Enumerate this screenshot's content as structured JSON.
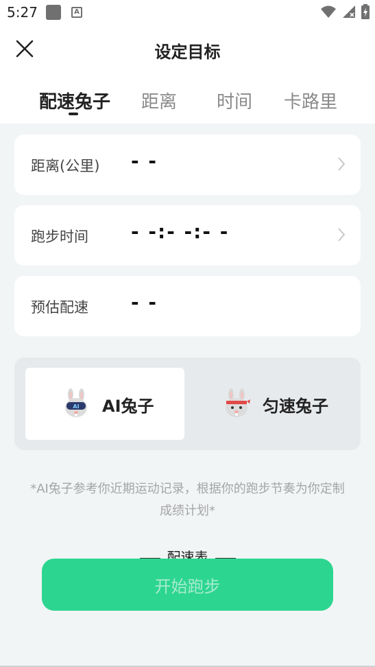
{
  "status_bar": {
    "time": "5:27"
  },
  "header": {
    "title": "设定目标",
    "tabs": [
      {
        "label": "配速兔子",
        "active": true
      },
      {
        "label": "距离",
        "active": false
      },
      {
        "label": "时间",
        "active": false
      },
      {
        "label": "卡路里",
        "active": false
      }
    ]
  },
  "cards": [
    {
      "label": "距离(公里)",
      "value": "- -",
      "has_chevron": true
    },
    {
      "label": "跑步时间",
      "value": "- -:- -:- -",
      "has_chevron": true
    },
    {
      "label": "预估配速",
      "value": "- -",
      "has_chevron": false
    }
  ],
  "modes": [
    {
      "label": "AI兔子",
      "icon": "ai-bunny-icon",
      "selected": true
    },
    {
      "label": "匀速兔子",
      "icon": "bunny-headband-icon",
      "selected": false
    }
  ],
  "note": "*AI兔子参考你近期运动记录，根据你的跑步节奏为你定制成绩计划*",
  "pace_table_title": "配速表",
  "start_button": "开始跑步",
  "colors": {
    "accent": "#2dd690",
    "start_text": "#a6ebcf",
    "background": "#f2f5f6"
  }
}
